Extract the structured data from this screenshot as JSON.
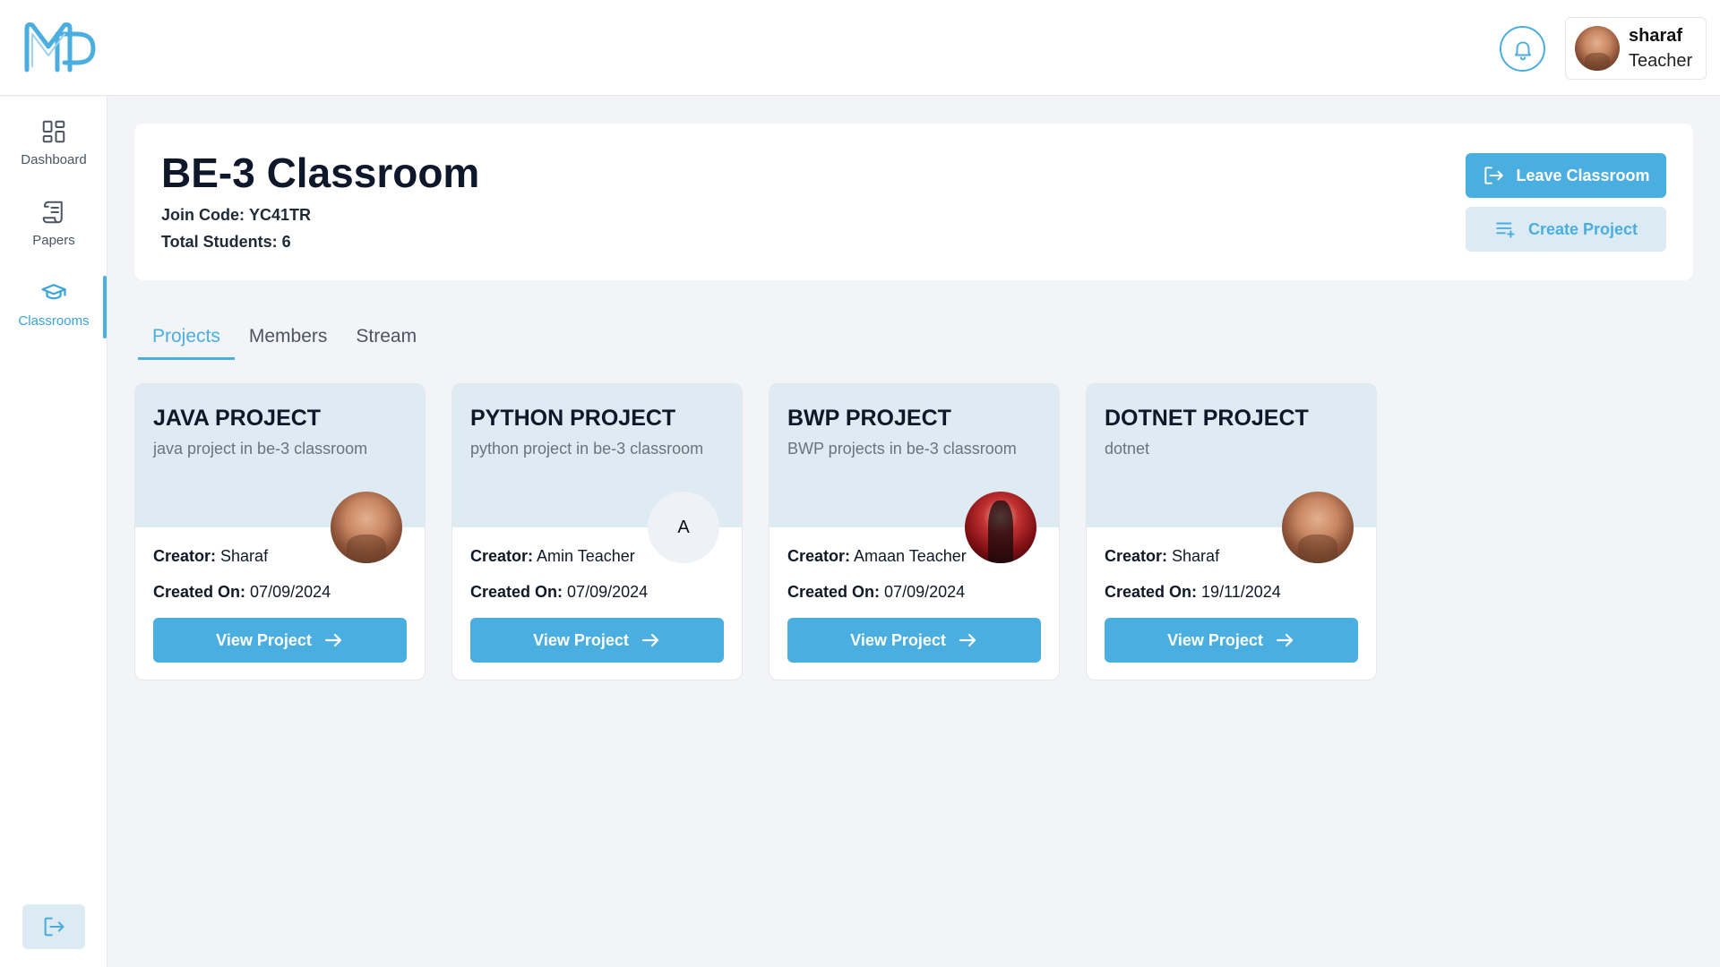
{
  "header": {
    "logo_text": "MP",
    "user": {
      "name": "sharaf",
      "role": "Teacher"
    }
  },
  "sidebar": {
    "items": [
      {
        "label": "Dashboard",
        "icon": "grid-icon"
      },
      {
        "label": "Papers",
        "icon": "scroll-icon"
      },
      {
        "label": "Classrooms",
        "icon": "graduation-cap-icon",
        "active": true
      }
    ]
  },
  "classroom": {
    "title": "BE-3 Classroom",
    "join_code_label": "Join Code:",
    "join_code": "YC41TR",
    "total_students_label": "Total Students:",
    "total_students": "6",
    "leave_button": "Leave Classroom",
    "create_button": "Create Project"
  },
  "tabs": [
    {
      "label": "Projects",
      "active": true
    },
    {
      "label": "Members"
    },
    {
      "label": "Stream"
    }
  ],
  "projects": [
    {
      "title": "JAVA PROJECT",
      "description": "java project in be-3 classroom",
      "creator_label": "Creator:",
      "creator": "Sharaf",
      "created_label": "Created On:",
      "created_on": "07/09/2024",
      "button": "View Project",
      "avatar": "photo"
    },
    {
      "title": "PYTHON PROJECT",
      "description": "python project in be-3 classroom",
      "creator_label": "Creator:",
      "creator": "Amin Teacher",
      "created_label": "Created On:",
      "created_on": "07/09/2024",
      "button": "View Project",
      "avatar": "letter",
      "avatar_letter": "A"
    },
    {
      "title": "BWP PROJECT",
      "description": "BWP projects in be-3 classroom",
      "creator_label": "Creator:",
      "creator": "Amaan Teacher",
      "created_label": "Created On:",
      "created_on": "07/09/2024",
      "button": "View Project",
      "avatar": "photo-red"
    },
    {
      "title": "DOTNET PROJECT",
      "description": "dotnet",
      "creator_label": "Creator:",
      "creator": "Sharaf",
      "created_label": "Created On:",
      "created_on": "19/11/2024",
      "button": "View Project",
      "avatar": "photo"
    }
  ],
  "colors": {
    "accent": "#4aaee0",
    "accent_light": "#dbeaf3",
    "card_top": "#dfebf2",
    "background": "#f2f4f7"
  }
}
